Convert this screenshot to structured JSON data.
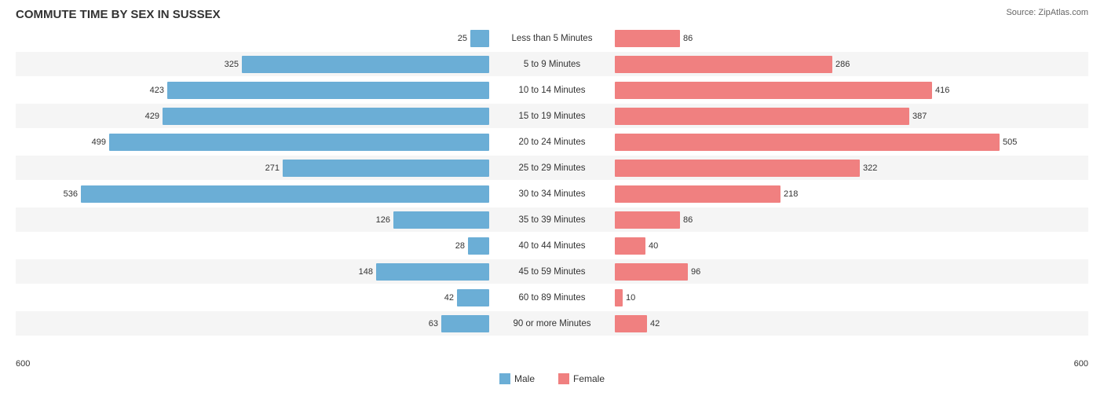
{
  "title": "COMMUTE TIME BY SEX IN SUSSEX",
  "source": "Source: ZipAtlas.com",
  "maxValue": 536,
  "pixelsPerUnit": 0.85,
  "rows": [
    {
      "label": "Less than 5 Minutes",
      "male": 25,
      "female": 86,
      "alt": false
    },
    {
      "label": "5 to 9 Minutes",
      "male": 325,
      "female": 286,
      "alt": true
    },
    {
      "label": "10 to 14 Minutes",
      "male": 423,
      "female": 416,
      "alt": false
    },
    {
      "label": "15 to 19 Minutes",
      "male": 429,
      "female": 387,
      "alt": true
    },
    {
      "label": "20 to 24 Minutes",
      "male": 499,
      "female": 505,
      "alt": false
    },
    {
      "label": "25 to 29 Minutes",
      "male": 271,
      "female": 322,
      "alt": true
    },
    {
      "label": "30 to 34 Minutes",
      "male": 536,
      "female": 218,
      "alt": false
    },
    {
      "label": "35 to 39 Minutes",
      "male": 126,
      "female": 86,
      "alt": true
    },
    {
      "label": "40 to 44 Minutes",
      "male": 28,
      "female": 40,
      "alt": false
    },
    {
      "label": "45 to 59 Minutes",
      "male": 148,
      "female": 96,
      "alt": true
    },
    {
      "label": "60 to 89 Minutes",
      "male": 42,
      "female": 10,
      "alt": false
    },
    {
      "label": "90 or more Minutes",
      "male": 63,
      "female": 42,
      "alt": true
    }
  ],
  "axis": {
    "left": "600",
    "right": "600"
  },
  "legend": {
    "male": "Male",
    "female": "Female"
  }
}
